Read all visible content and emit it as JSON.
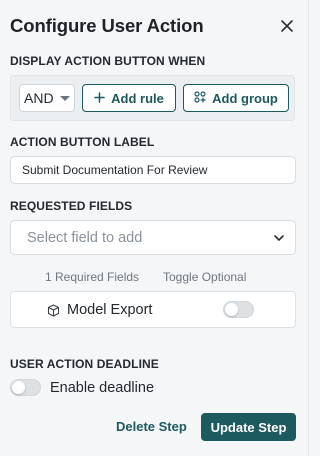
{
  "panel": {
    "title": "Configure User Action",
    "close_icon": "close-icon"
  },
  "display_when": {
    "label": "DISPLAY ACTION BUTTON WHEN",
    "operator": "AND",
    "add_rule_label": "Add rule",
    "add_group_label": "Add group"
  },
  "button_label": {
    "label": "ACTION BUTTON LABEL",
    "value": "Submit Documentation For Review"
  },
  "requested_fields": {
    "label": "REQUESTED FIELDS",
    "placeholder": "Select field to add",
    "required_count_text": "1 Required Fields",
    "toggle_optional_text": "Toggle Optional",
    "fields": [
      {
        "name": "Model Export",
        "optional": false,
        "icon": "cube-icon"
      }
    ]
  },
  "deadline": {
    "label": "USER ACTION DEADLINE",
    "enable_label": "Enable deadline",
    "enabled": false
  },
  "footer": {
    "delete_label": "Delete Step",
    "update_label": "Update Step"
  },
  "colors": {
    "accent": "#1c5a5f",
    "background": "#f4f6f7"
  }
}
